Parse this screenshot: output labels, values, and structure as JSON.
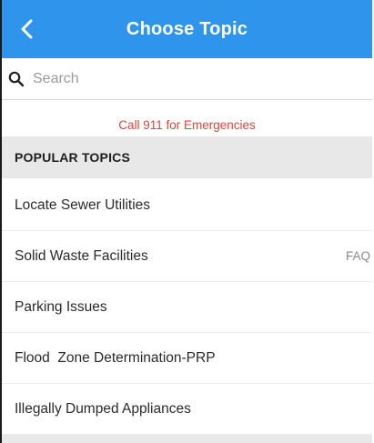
{
  "header": {
    "title": "Choose Topic",
    "back_icon": "chevron-left-icon",
    "color": "#2f95ec"
  },
  "search": {
    "placeholder": "Search",
    "value": "",
    "icon": "search-icon"
  },
  "notice": {
    "text": "Call 911 for Emergencies",
    "color": "#e0443a"
  },
  "section": {
    "title": "POPULAR TOPICS"
  },
  "topics": [
    {
      "label": "Locate Sewer Utilities",
      "badge": ""
    },
    {
      "label": "Solid Waste Facilities",
      "badge": "FAQ"
    },
    {
      "label": "Parking Issues",
      "badge": ""
    },
    {
      "label": "Flood  Zone Determination-PRP",
      "badge": ""
    },
    {
      "label": "Illegally Dumped Appliances",
      "badge": ""
    }
  ]
}
